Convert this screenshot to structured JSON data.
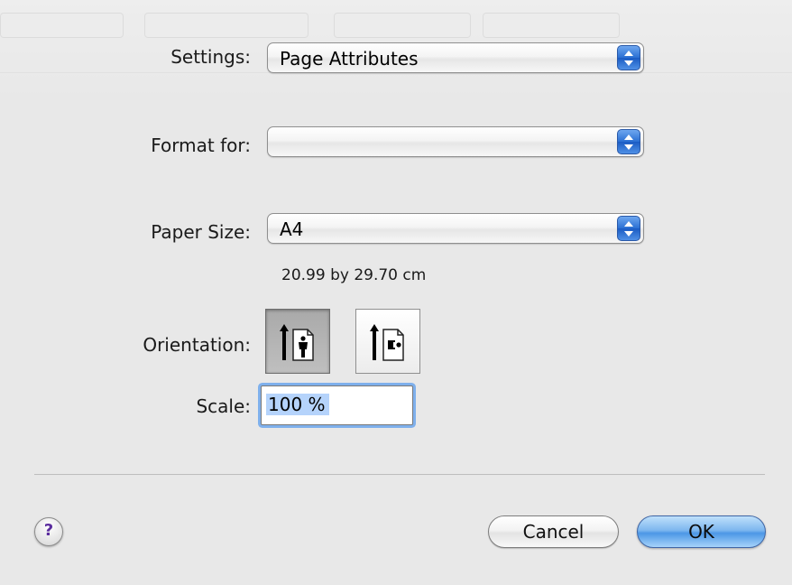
{
  "dialog": {
    "settings": {
      "label": "Settings:",
      "value": "Page Attributes"
    },
    "format_for": {
      "label": "Format for:",
      "value": ""
    },
    "paper_size": {
      "label": "Paper Size:",
      "value": "A4",
      "dimensions": "20.99 by 29.70 cm"
    },
    "orientation": {
      "label": "Orientation:",
      "options": [
        "portrait",
        "landscape"
      ],
      "selected": "portrait"
    },
    "scale": {
      "label": "Scale:",
      "value": "100 %"
    },
    "help": {
      "glyph": "?"
    },
    "buttons": {
      "cancel": "Cancel",
      "ok": "OK"
    }
  },
  "colors": {
    "accent": "#2a6fd3",
    "help_glyph": "#5b2d9e",
    "selection": "#b5d3fb"
  },
  "icons": {
    "popup_arrows": "updown-arrows-icon",
    "portrait": "portrait-orientation-icon",
    "landscape": "landscape-orientation-icon",
    "help": "help-icon"
  }
}
